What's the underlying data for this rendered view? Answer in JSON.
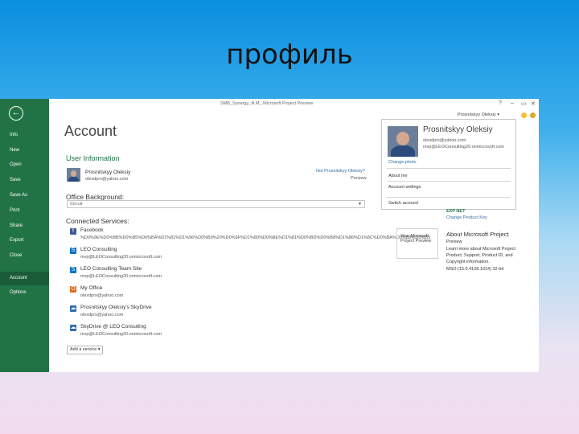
{
  "slide": {
    "title": "профиль"
  },
  "window": {
    "doc_title": "SMB_Synergy_Ф.М_ Microsoft Project Preview",
    "user_short": "Prosnitskyy Oleksiy ▾",
    "controls": [
      "?",
      "–",
      "▭",
      "✕"
    ]
  },
  "sidebar": {
    "back": "←",
    "items": [
      "Info",
      "New",
      "Open",
      "Save",
      "Save As",
      "Print",
      "Share",
      "Export",
      "Close",
      "Account",
      "Options"
    ],
    "active_index": 9
  },
  "account": {
    "title": "Account",
    "user_info": {
      "heading": "User Information",
      "name": "Prosnitskyy Oleksiy",
      "email": "olexdprs@yahoo.com",
      "link_change": "Not Prosnitskyy Oleksiy?",
      "link_preview": "Preview"
    },
    "office_bg": {
      "heading": "Office Background:",
      "value": "Circuit"
    },
    "services": {
      "heading": "Connected Services:",
      "items": [
        {
          "icon": "f",
          "color": "#3b5998",
          "name": "Facebook",
          "detail": "%D0%9E%D0%BB%D0%B5%D0%BA%D1%81%D1%96%D0%B9%20%D0%9F%D1%80%D0%BE%D1%81%D0%BD%D0%B8%D1%86%D1%8C%D0%BA%D0%B8%D0%B9"
        },
        {
          "icon": "S",
          "color": "#0072c6",
          "name": "LEO Consulting",
          "detail": "mvp@LEOConsulting20.onmicrosoft.com"
        },
        {
          "icon": "S",
          "color": "#0072c6",
          "name": "LEO Consulting Team Site",
          "detail": "mvp@LEOConsulting20.onmicrosoft.com"
        },
        {
          "icon": "O",
          "color": "#e06a1a",
          "name": "My Office",
          "detail": "olexdprs@yahoo.com"
        },
        {
          "icon": "☁",
          "color": "#2d6db5",
          "name": "Prosnitskyy Oleksiy's SkyDrive",
          "detail": "olexdprs@yahoo.com"
        },
        {
          "icon": "☁",
          "color": "#2d6db5",
          "name": "SkyDrive @ LEO Consulting",
          "detail": "mvp@LEOConsulting20.onmicrosoft.com"
        }
      ]
    },
    "add_service": "Add a service ▾"
  },
  "popup": {
    "name": "Prosnitskyy Oleksiy",
    "email1": "olexdprs@yahoo.com",
    "email2": "mvp@LEOConsulting20.onmicrosoft.com",
    "change_photo": "Change photo",
    "about_me": "About me",
    "account_settings": "Account settings",
    "switch_account": "Switch account"
  },
  "about": {
    "mnt_label": "EXP NET",
    "mnt_sub": "Change Product Key",
    "logo_text": "Your Microsoft Project Preview",
    "title": "About Microsoft Project",
    "line1": "Preview",
    "line2": "Learn more about Microsoft Project",
    "line3": "Product, Support, Product ID, and",
    "line4": "Copyright information.",
    "line5": "MSO (15.0.4128.1014) 32-bit"
  }
}
